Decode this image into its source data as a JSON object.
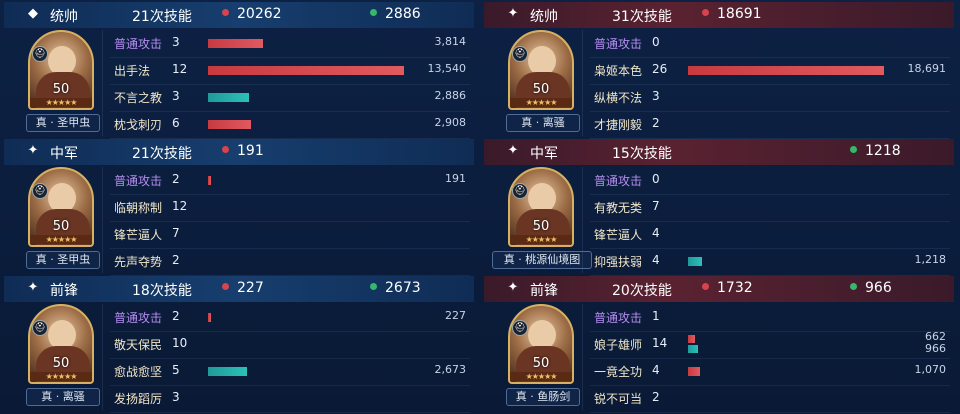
{
  "left": {
    "blocks": [
      {
        "role": "统帅",
        "skills": "21次技能",
        "damage": "20262",
        "heal": "2886",
        "general_level": "50",
        "general_tag": "真 · 圣甲虫",
        "rows": [
          {
            "name": "普通攻击",
            "count": "3",
            "val": "3,814",
            "damage_fraction": 0.28
          },
          {
            "name": "出手法",
            "count": "12",
            "val": "13,540",
            "damage_fraction": 1.0
          },
          {
            "name": "不言之教",
            "count": "3",
            "val": "2,886",
            "heal_fraction": 0.21
          },
          {
            "name": "枕戈刺刃",
            "count": "6",
            "val": "2,908",
            "damage_fraction": 0.22
          }
        ]
      },
      {
        "role": "中军",
        "skills": "21次技能",
        "damage": "191",
        "heal": "",
        "general_level": "50",
        "general_tag": "真 · 圣甲虫",
        "rows": [
          {
            "name": "普通攻击",
            "count": "2",
            "val": "191",
            "damage_fraction": 0.01
          },
          {
            "name": "临朝称制",
            "count": "12",
            "val": ""
          },
          {
            "name": "锋芒逼人",
            "count": "7",
            "val": ""
          },
          {
            "name": "先声夺势",
            "count": "2",
            "val": ""
          }
        ]
      },
      {
        "role": "前锋",
        "skills": "18次技能",
        "damage": "227",
        "heal": "2673",
        "general_level": "50",
        "general_tag": "真 · 离骚",
        "rows": [
          {
            "name": "普通攻击",
            "count": "2",
            "val": "227",
            "damage_fraction": 0.01
          },
          {
            "name": "敬天保民",
            "count": "10",
            "val": ""
          },
          {
            "name": "愈战愈坚",
            "count": "5",
            "val": "2,673",
            "heal_fraction": 0.2
          },
          {
            "name": "发扬蹈厉",
            "count": "3",
            "val": ""
          }
        ]
      }
    ]
  },
  "right": {
    "blocks": [
      {
        "role": "统帅",
        "skills": "31次技能",
        "damage": "18691",
        "heal": "",
        "general_level": "50",
        "general_tag": "真 · 离骚",
        "rows": [
          {
            "name": "普通攻击",
            "count": "0",
            "val": ""
          },
          {
            "name": "枭姬本色",
            "count": "26",
            "val": "18,691",
            "damage_fraction": 1.0
          },
          {
            "name": "纵横不法",
            "count": "3",
            "val": ""
          },
          {
            "name": "才捷刚毅",
            "count": "2",
            "val": ""
          }
        ]
      },
      {
        "role": "中军",
        "skills": "15次技能",
        "damage": "",
        "heal": "1218",
        "general_level": "50",
        "general_tag": "真 · 桃源仙境图",
        "rows": [
          {
            "name": "普通攻击",
            "count": "0",
            "val": ""
          },
          {
            "name": "有教无类",
            "count": "7",
            "val": ""
          },
          {
            "name": "锋芒逼人",
            "count": "4",
            "val": ""
          },
          {
            "name": "抑强扶弱",
            "count": "4",
            "val": "1,218",
            "heal_fraction": 0.07
          }
        ]
      },
      {
        "role": "前锋",
        "skills": "20次技能",
        "damage": "1732",
        "heal": "966",
        "general_level": "50",
        "general_tag": "真 · 鱼肠剑",
        "rows": [
          {
            "name": "普通攻击",
            "count": "1",
            "val": ""
          },
          {
            "name": "娘子雄师",
            "count": "14",
            "val": "662",
            "val2": "966",
            "damage_fraction": 0.035,
            "heal_fraction": 0.05
          },
          {
            "name": "一竟全功",
            "count": "4",
            "val": "1,070",
            "damage_fraction": 0.06
          },
          {
            "name": "锐不可当",
            "count": "2",
            "val": ""
          }
        ]
      }
    ]
  },
  "colors": {
    "damage": "#d8434d",
    "heal": "#36b86b",
    "basic_attack": "#b58cf0"
  },
  "icons": {
    "role_mark": "spark-icon",
    "commander_badge": "helmet-icon"
  }
}
